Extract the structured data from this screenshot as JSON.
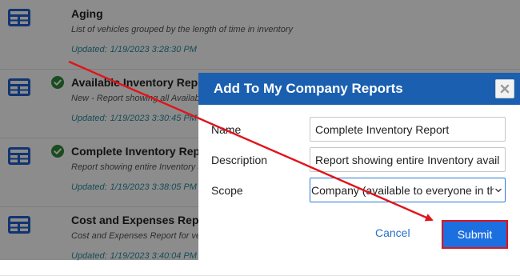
{
  "reports": [
    {
      "title": "Aging",
      "description": "List of vehicles grouped by the length of time in inventory",
      "updated_label": "Updated:",
      "updated_time": "1/19/2023 3:28:30 PM",
      "checked": false
    },
    {
      "title": "Available Inventory Report",
      "description": "New - Report showing all Available Inventory",
      "updated_label": "Updated:",
      "updated_time": "1/19/2023 3:30:45 PM",
      "checked": true
    },
    {
      "title": "Complete Inventory Report",
      "description": "Report showing entire Inventory available",
      "updated_label": "Updated:",
      "updated_time": "1/19/2023 3:38:05 PM",
      "checked": true
    },
    {
      "title": "Cost and Expenses Report",
      "description": "Cost and Expenses Report for vehicles",
      "updated_label": "Updated:",
      "updated_time": "1/19/2023 3:40:04 PM",
      "checked": false
    }
  ],
  "modal": {
    "title": "Add To My Company Reports",
    "close_symbol": "×",
    "fields": {
      "name": {
        "label": "Name",
        "value": "Complete Inventory Report"
      },
      "description": {
        "label": "Description",
        "value": "Report showing entire Inventory available to everyone"
      },
      "scope": {
        "label": "Scope",
        "value": "Company (available to everyone in the company)"
      }
    },
    "cancel_label": "Cancel",
    "submit_label": "Submit"
  },
  "colors": {
    "header_blue": "#1b5fb0",
    "icon_blue": "#1f5fcf",
    "check_green": "#2e8b3a",
    "updated_teal": "#2c8c9c",
    "submit_blue": "#1c6fe0",
    "highlight_red": "#e0141b"
  },
  "icons": {
    "report": "table-icon",
    "check": "check-circle-icon",
    "close": "close-icon",
    "chevron": "chevron-down-icon"
  }
}
